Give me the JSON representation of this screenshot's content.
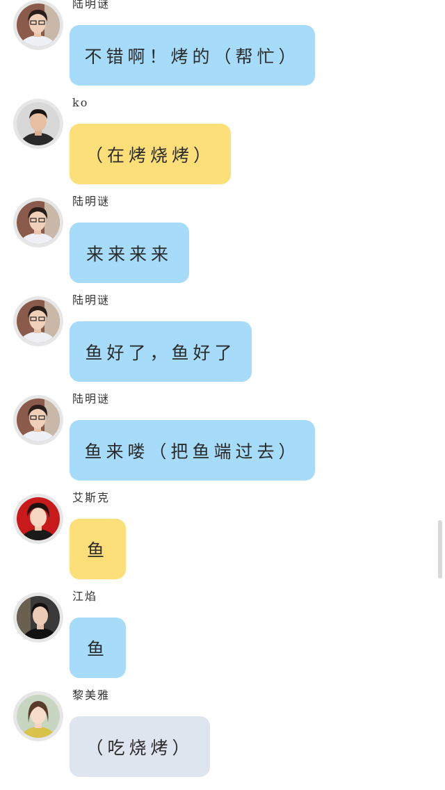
{
  "colors": {
    "blue_bubble": "#a6dcfa",
    "yellow_bubble": "#fcdf78",
    "grey_bubble": "#dfe5ee"
  },
  "messages": [
    {
      "sender": "陆明谜",
      "text": "不错啊！烤的（帮忙）",
      "bubble": "blue",
      "avatar": "lu-mingmi-avatar"
    },
    {
      "sender": "ko",
      "text": "（在烤烧烤）",
      "bubble": "yellow",
      "avatar": "ko-avatar"
    },
    {
      "sender": "陆明谜",
      "text": "来来来来",
      "bubble": "blue",
      "avatar": "lu-mingmi-avatar"
    },
    {
      "sender": "陆明谜",
      "text": "鱼好了，鱼好了",
      "bubble": "blue",
      "avatar": "lu-mingmi-avatar"
    },
    {
      "sender": "陆明谜",
      "text": "鱼来喽（把鱼端过去）",
      "bubble": "blue",
      "avatar": "lu-mingmi-avatar"
    },
    {
      "sender": "艾斯克",
      "text": "鱼",
      "bubble": "yellow",
      "avatar": "aisike-avatar"
    },
    {
      "sender": "江焰",
      "text": "鱼",
      "bubble": "blue",
      "avatar": "jiangyan-avatar"
    },
    {
      "sender": "黎美雅",
      "text": "（吃烧烤）",
      "bubble": "grey",
      "avatar": "limeiya-avatar"
    }
  ]
}
